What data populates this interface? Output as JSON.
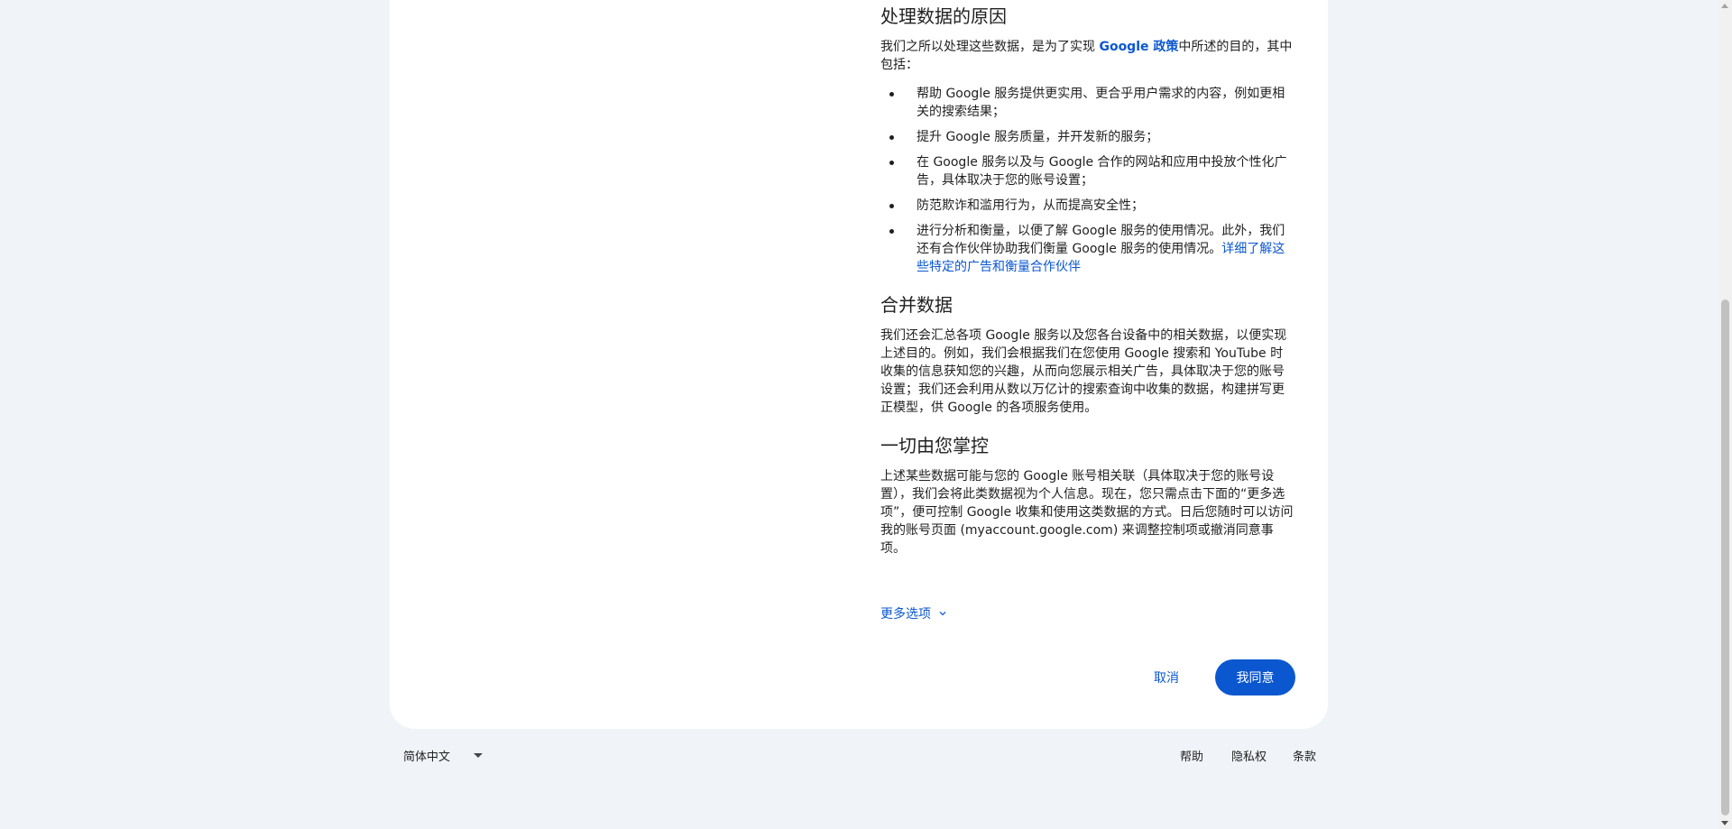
{
  "section_partial": {
    "heading": "……"
  },
  "reasons": {
    "heading": "处理数据的原因",
    "intro_before": "我们之所以处理这些数据，是为了实现 ",
    "intro_link": "Google 政策",
    "intro_after": "中所述的目的，其中包括：",
    "items": [
      "帮助 Google 服务提供更实用、更合乎用户需求的内容，例如更相关的搜索结果；",
      "提升 Google 服务质量，并开发新的服务；",
      "在 Google 服务以及与 Google 合作的网站和应用中投放个性化广告，具体取决于您的账号设置；",
      "防范欺诈和滥用行为，从而提高安全性；"
    ],
    "last_item_text": "进行分析和衡量，以便了解 Google 服务的使用情况。此外，我们还有合作伙伴协助我们衡量 Google 服务的使用情况。",
    "last_item_link": "详细了解这些特定的广告和衡量合作伙伴"
  },
  "combine": {
    "heading": "合并数据",
    "body": "我们还会汇总各项 Google 服务以及您各台设备中的相关数据，以便实现上述目的。例如，我们会根据我们在您使用 Google 搜索和 YouTube 时收集的信息获知您的兴趣，从而向您展示相关广告，具体取决于您的账号设置；我们还会利用从数以万亿计的搜索查询中收集的数据，构建拼写更正模型，供 Google 的各项服务使用。"
  },
  "control": {
    "heading": "一切由您掌控",
    "body": "上述某些数据可能与您的 Google 账号相关联（具体取决于您的账号设置），我们会将此类数据视为个人信息。现在，您只需点击下面的“更多选项”，便可控制 Google 收集和使用这类数据的方式。日后您随时可以访问我的账号页面 (myaccount.google.com) 来调整控制项或撤消同意事项。"
  },
  "more_options": {
    "label": "更多选项",
    "icon": "chevron-down-icon"
  },
  "actions": {
    "cancel": "取消",
    "agree": "我同意"
  },
  "footer": {
    "language": "简体中文",
    "links": [
      "帮助",
      "隐私权",
      "条款"
    ]
  },
  "colors": {
    "background": "#f0f4f9",
    "card": "#ffffff",
    "link": "#0b57d0",
    "primary_button": "#0b57d0",
    "text": "#1f1f1f"
  }
}
